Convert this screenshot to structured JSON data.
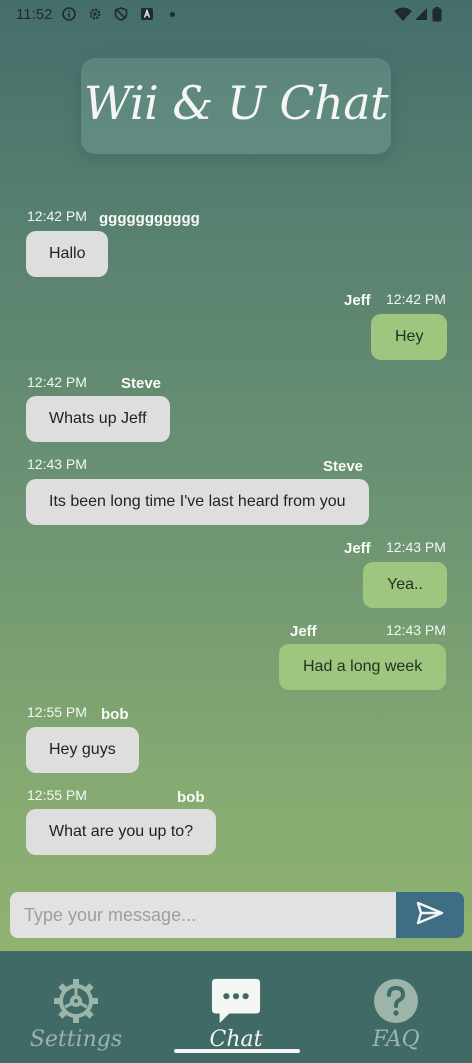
{
  "status_bar": {
    "time": "11:52",
    "left_icons": [
      "info-icon",
      "settings-gear-icon",
      "vpn-shield-icon",
      "app-notification-icon",
      "dot-icon"
    ],
    "right_icons": [
      "wifi-icon",
      "cellular-signal-icon",
      "battery-icon"
    ]
  },
  "header": {
    "title": "Wii & U Chat"
  },
  "messages": [
    {
      "direction": "incoming",
      "time": "12:42 PM",
      "sender": "ggggggggggg",
      "text": "Hallo"
    },
    {
      "direction": "outgoing",
      "time": "12:42 PM",
      "sender": "Jeff",
      "text": "Hey"
    },
    {
      "direction": "incoming",
      "time": "12:42 PM",
      "sender": "Steve",
      "text": "Whats up Jeff"
    },
    {
      "direction": "incoming",
      "time": "12:43 PM",
      "sender": "Steve",
      "text": "Its been long time I've last heard from you"
    },
    {
      "direction": "outgoing",
      "time": "12:43 PM",
      "sender": "Jeff",
      "text": "Yea.."
    },
    {
      "direction": "outgoing",
      "time": "12:43 PM",
      "sender": "Jeff",
      "text": "Had a long week"
    },
    {
      "direction": "incoming",
      "time": "12:55 PM",
      "sender": "bob",
      "text": "Hey guys"
    },
    {
      "direction": "incoming",
      "time": "12:55 PM",
      "sender": "bob",
      "text": "What are you up to?"
    }
  ],
  "composer": {
    "placeholder": "Type your message...",
    "value": "",
    "send_icon": "send-arrow-icon"
  },
  "bottom_nav": {
    "items": [
      {
        "label": "Settings",
        "icon": "gear-icon",
        "active": false
      },
      {
        "label": "Chat",
        "icon": "chat-bubble-icon",
        "active": true
      },
      {
        "label": "FAQ",
        "icon": "question-circle-icon",
        "active": false
      }
    ]
  },
  "colors": {
    "bubble_incoming": "#dedede",
    "bubble_outgoing": "#9fc67e",
    "send_button": "#3f6e84",
    "nav_background": "#3f6a66"
  }
}
